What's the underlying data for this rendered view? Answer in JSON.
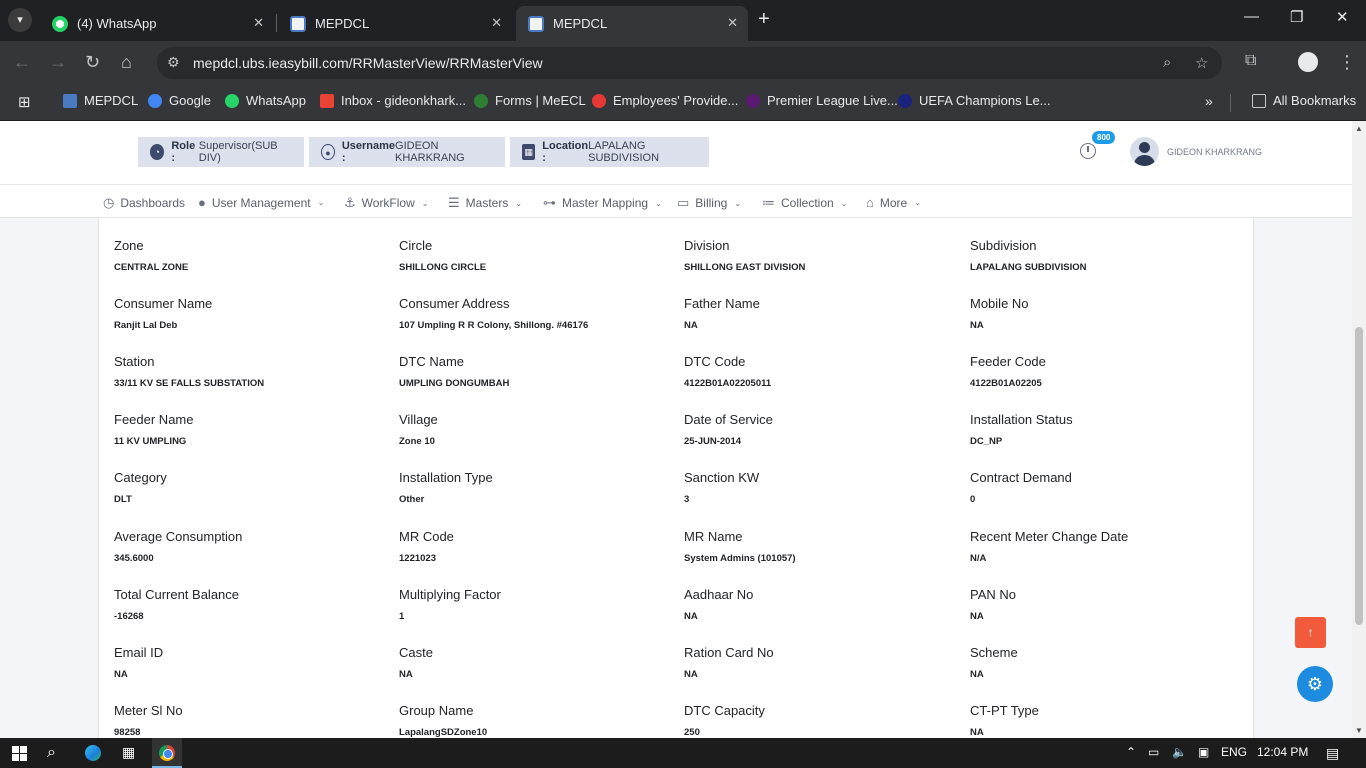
{
  "browser": {
    "tabs": [
      {
        "title": "(4) WhatsApp",
        "icon": "whatsapp-icon"
      },
      {
        "title": "MEPDCL",
        "icon": "document-icon"
      },
      {
        "title": "MEPDCL",
        "icon": "document-icon",
        "active": true
      }
    ],
    "url_host": "mepdcl.ubs.ieasybill.com",
    "url_path": "/RRMasterView/RRMasterView",
    "bookmarks": [
      {
        "label": "MEPDCL",
        "color": "#4a7abf"
      },
      {
        "label": "Google",
        "color": "#4285f4"
      },
      {
        "label": "WhatsApp",
        "color": "#25d366"
      },
      {
        "label": "Inbox - gideonkhark...",
        "color": "#ea4335"
      },
      {
        "label": "Forms | MeECL",
        "color": "#2e7d32"
      },
      {
        "label": "Employees' Provide...",
        "color": "#e53935"
      },
      {
        "label": "Premier League Live...",
        "color": "#5b1a72"
      },
      {
        "label": "UEFA Champions Le...",
        "color": "#1a237e"
      }
    ],
    "all_bookmarks": "All Bookmarks"
  },
  "header": {
    "role_label": "Role :",
    "role_value": "Supervisor(SUB DIV)",
    "username_label": "Username :",
    "username_value": "GIDEON KHARKRANG",
    "location_label": "Location :",
    "location_value": "LAPALANG SUBDIVISION",
    "notification_count": "800",
    "user_display": "GIDEON KHARKRANG"
  },
  "menu": [
    {
      "label": "Dashboards",
      "icon": "dashboard-icon",
      "dropdown": false
    },
    {
      "label": "User Management",
      "icon": "user-icon",
      "dropdown": true
    },
    {
      "label": "WorkFlow",
      "icon": "anchor-icon",
      "dropdown": true
    },
    {
      "label": "Masters",
      "icon": "list-icon",
      "dropdown": true
    },
    {
      "label": "Master Mapping",
      "icon": "sitemap-icon",
      "dropdown": true
    },
    {
      "label": "Billing",
      "icon": "monitor-icon",
      "dropdown": true
    },
    {
      "label": "Collection",
      "icon": "list-check-icon",
      "dropdown": true
    },
    {
      "label": "More",
      "icon": "briefcase-icon",
      "dropdown": true
    }
  ],
  "fields": [
    [
      {
        "label": "Zone",
        "value": "CENTRAL ZONE"
      },
      {
        "label": "Circle",
        "value": "SHILLONG CIRCLE"
      },
      {
        "label": "Division",
        "value": "SHILLONG EAST DIVISION"
      },
      {
        "label": "Subdivision",
        "value": "LAPALANG SUBDIVISION"
      }
    ],
    [
      {
        "label": "Consumer Name",
        "value": "Ranjit Lal Deb"
      },
      {
        "label": "Consumer Address",
        "value": "107 Umpling R R Colony, Shillong. #46176"
      },
      {
        "label": "Father Name",
        "value": "NA"
      },
      {
        "label": "Mobile No",
        "value": "NA"
      }
    ],
    [
      {
        "label": "Station",
        "value": "33/11 KV SE FALLS SUBSTATION"
      },
      {
        "label": "DTC Name",
        "value": "UMPLING DONGUMBAH"
      },
      {
        "label": "DTC Code",
        "value": "4122B01A02205011"
      },
      {
        "label": "Feeder Code",
        "value": "4122B01A02205"
      }
    ],
    [
      {
        "label": "Feeder Name",
        "value": "11 KV UMPLING"
      },
      {
        "label": "Village",
        "value": "Zone 10"
      },
      {
        "label": "Date of Service",
        "value": "25-JUN-2014"
      },
      {
        "label": "Installation Status",
        "value": "DC_NP"
      }
    ],
    [
      {
        "label": "Category",
        "value": "DLT"
      },
      {
        "label": "Installation Type",
        "value": "Other"
      },
      {
        "label": "Sanction KW",
        "value": "3"
      },
      {
        "label": "Contract Demand",
        "value": "0"
      }
    ],
    [
      {
        "label": "Average Consumption",
        "value": "345.6000"
      },
      {
        "label": "MR Code",
        "value": "1221023"
      },
      {
        "label": "MR Name",
        "value": "System Admins (101057)"
      },
      {
        "label": "Recent Meter Change Date",
        "value": "N/A"
      }
    ],
    [
      {
        "label": "Total Current Balance",
        "value": "-16268"
      },
      {
        "label": "Multiplying Factor",
        "value": "1"
      },
      {
        "label": "Aadhaar No",
        "value": "NA"
      },
      {
        "label": "PAN No",
        "value": "NA"
      }
    ],
    [
      {
        "label": "Email ID",
        "value": "NA"
      },
      {
        "label": "Caste",
        "value": "NA"
      },
      {
        "label": "Ration Card No",
        "value": "NA"
      },
      {
        "label": "Scheme",
        "value": "NA"
      }
    ],
    [
      {
        "label": "Meter Sl No",
        "value": "98258"
      },
      {
        "label": "Group Name",
        "value": "LapalangSDZone10"
      },
      {
        "label": "DTC Capacity",
        "value": "250"
      },
      {
        "label": "CT-PT Type",
        "value": "NA"
      }
    ]
  ],
  "taskbar": {
    "language": "ENG",
    "time": "12:04 PM"
  }
}
